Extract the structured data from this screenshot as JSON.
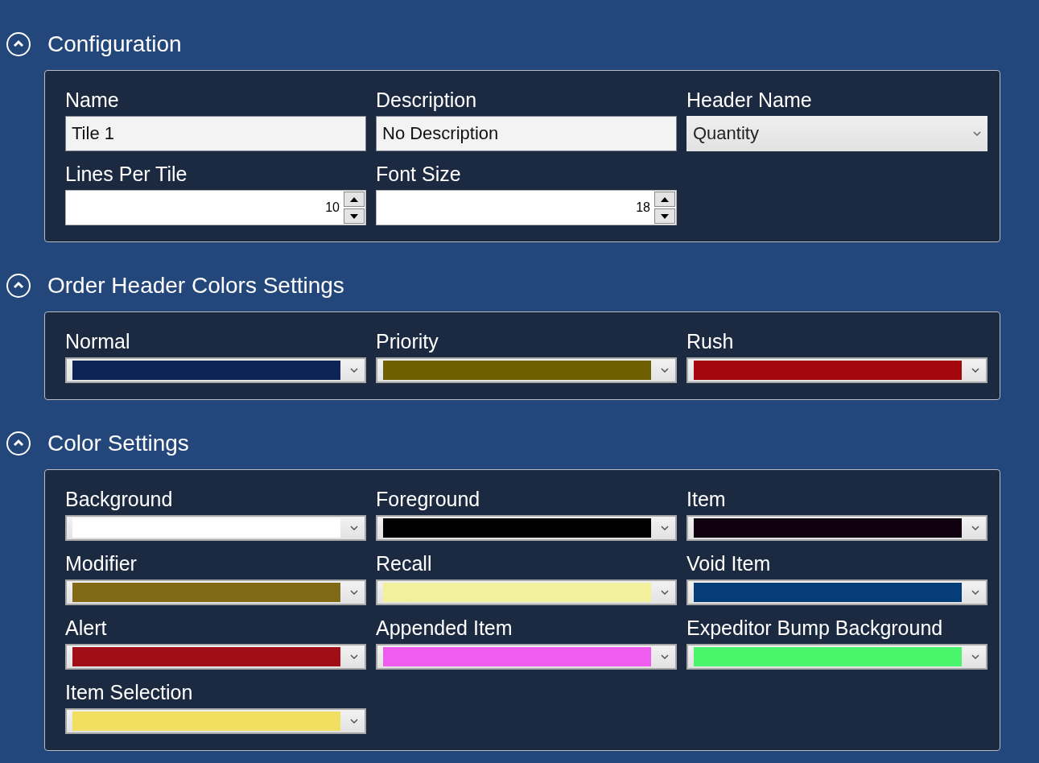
{
  "sections": [
    {
      "title": "Configuration",
      "expanded": true,
      "fields": [
        {
          "label": "Name",
          "kind": "text",
          "value": "Tile 1"
        },
        {
          "label": "Description",
          "kind": "text",
          "value": "No Description"
        },
        {
          "label": "Header Name",
          "kind": "dropdown",
          "value": "Quantity"
        },
        {
          "label": "Lines Per Tile",
          "kind": "spinner",
          "value": "10"
        },
        {
          "label": "Font Size",
          "kind": "spinner",
          "value": "18"
        }
      ]
    },
    {
      "title": "Order Header Colors Settings",
      "expanded": true,
      "fields": [
        {
          "label": "Normal",
          "kind": "color",
          "color": "#0e2358"
        },
        {
          "label": "Priority",
          "kind": "color",
          "color": "#6e5f00"
        },
        {
          "label": "Rush",
          "kind": "color",
          "color": "#a4070e"
        }
      ]
    },
    {
      "title": "Color Settings",
      "expanded": true,
      "fields": [
        {
          "label": "Background",
          "kind": "color",
          "color": "#ffffff"
        },
        {
          "label": "Foreground",
          "kind": "color",
          "color": "#000000"
        },
        {
          "label": "Item",
          "kind": "color",
          "color": "#0f0010"
        },
        {
          "label": "Modifier",
          "kind": "color",
          "color": "#806a15"
        },
        {
          "label": "Recall",
          "kind": "color",
          "color": "#f2f09a"
        },
        {
          "label": "Void Item",
          "kind": "color",
          "color": "#043d78"
        },
        {
          "label": "Alert",
          "kind": "color",
          "color": "#a10e15"
        },
        {
          "label": "Appended Item",
          "kind": "color",
          "color": "#ee5ded"
        },
        {
          "label": "Expeditor Bump Background",
          "kind": "color",
          "color": "#4bf56b"
        },
        {
          "label": "Item Selection",
          "kind": "color",
          "color": "#f0df60"
        }
      ]
    }
  ]
}
